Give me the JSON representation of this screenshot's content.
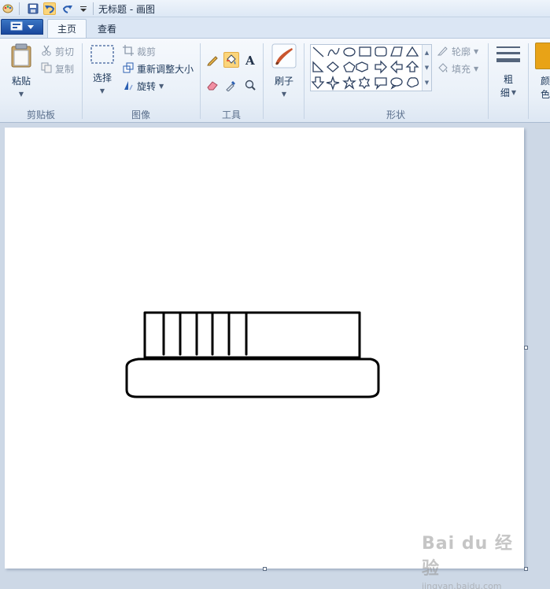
{
  "window": {
    "title": "无标题 - 画图"
  },
  "tabs": [
    {
      "label": "主页",
      "active": true
    },
    {
      "label": "查看",
      "active": false
    }
  ],
  "ribbon": {
    "clipboard": {
      "group_label": "剪贴板",
      "paste": "粘贴",
      "cut": "剪切",
      "copy": "复制"
    },
    "image": {
      "group_label": "图像",
      "select": "选择",
      "crop": "裁剪",
      "resize": "重新调整大小",
      "rotate": "旋转"
    },
    "tools": {
      "group_label": "工具",
      "items": [
        "pencil-icon",
        "fill-icon",
        "text-icon",
        "eraser-icon",
        "color-picker-icon",
        "magnifier-icon"
      ],
      "active_tool": "fill-icon"
    },
    "brushes": {
      "label": "刷子"
    },
    "shapes": {
      "group_label": "形状",
      "outline": "轮廓",
      "fill": "填充"
    },
    "size": {
      "label_line1": "粗",
      "label_line2": "细"
    },
    "color": {
      "label_line1": "颜",
      "label_line2": "色",
      "swatch": "#e8a317"
    }
  },
  "watermark": {
    "brand": "Bai du 经验",
    "url": "jingyan.baidu.com"
  },
  "colors": {
    "accent": "#1f5bb5",
    "highlight": "#fbd57b",
    "workspace": "#cdd8e6"
  }
}
